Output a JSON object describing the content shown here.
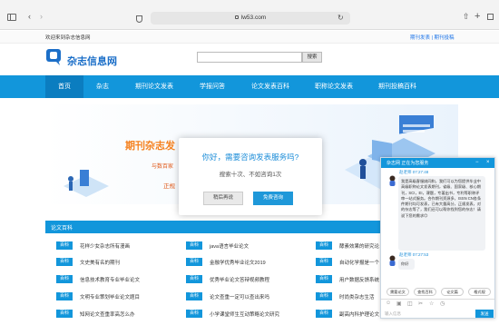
{
  "browser": {
    "url": "lw53.com"
  },
  "topstrip": {
    "welcome": "欢迎来到杂志信息网",
    "links": "期刊发表 | 期刊投稿"
  },
  "header": {
    "site_name": "杂志信息网",
    "search_button": "搜索"
  },
  "nav": {
    "items": [
      {
        "label": "首页"
      },
      {
        "label": "杂志"
      },
      {
        "label": "期刊论文发表"
      },
      {
        "label": "学报问答"
      },
      {
        "label": "论文发表百科"
      },
      {
        "label": "职称论文发表"
      },
      {
        "label": "期刊投稿百科"
      }
    ]
  },
  "banner": {
    "title": "期刊杂志发",
    "sub": "与数百家",
    "sub2": "正规"
  },
  "modal": {
    "title": "你好，需要咨询发表服务吗?",
    "subtitle": "搜索十次、不如咨询1次",
    "later_button": "稍后再说",
    "consult_button": "免费咨询"
  },
  "section": {
    "title": "论文百科",
    "tag": "百科",
    "col1": [
      "花样少女杂志所有漫画",
      "文史美有名的期刊",
      "信息技术教育专业毕业论文",
      "文明专业策划毕业论文题目",
      "知网论文查重率高怎么办"
    ],
    "col2": [
      "java语言毕业论文",
      "金融学优秀毕业论文2019",
      "优秀毕业论文答辩视频教程",
      "论文查重一定可以查出来吗",
      "小学课堂师生互动策略论文研究"
    ],
    "col3": [
      "酵素效果的研究论",
      "自动化学报是一个",
      "用户数据反馈系统",
      "时尚类杂志生活",
      "副高内科护理论文"
    ]
  },
  "chat": {
    "title": "杂志网 正在为您服务",
    "agent1": "赵老师 07:27:48",
    "message1": "我是高级客服姚同和，我们可以为您提供毕业中高级职称论文发表期刊，省级、国家级、核心期刊，SCI，EI，课题，专著出书，专利等职称评审一站式服务。合作期刊资源多，ISSN CN各条件期刊均可发表，已有大量高分，正规发表，对的杂志等了，我们还可以帮你找到您的杂志！请说下您的需求😊",
    "agent2": "赵老师 07:27:53",
    "message2": "你好",
    "quick": [
      "需要论文",
      "查找百科",
      "论文篇",
      "格式规"
    ],
    "input_placeholder": "输入信息",
    "send_button": "发送"
  }
}
